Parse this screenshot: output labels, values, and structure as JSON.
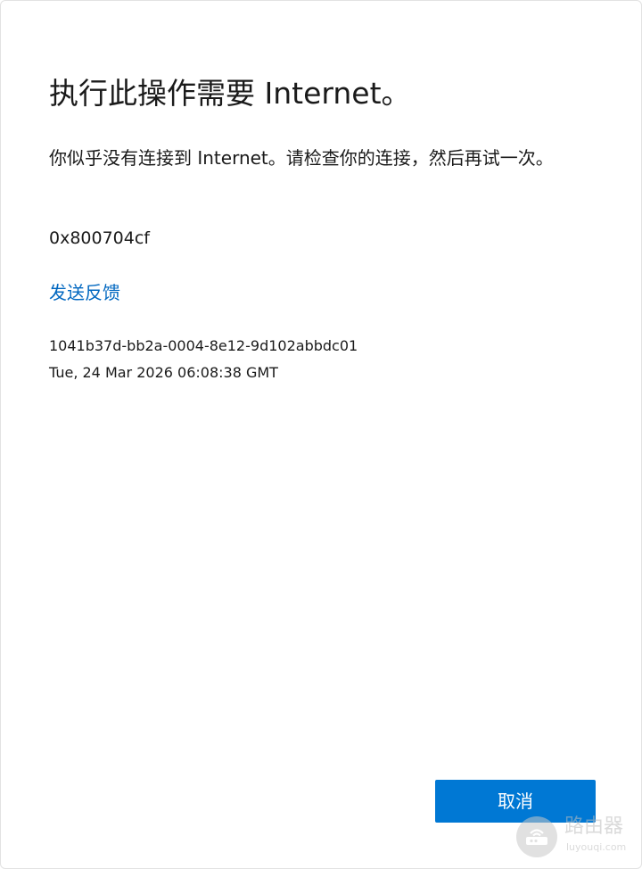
{
  "dialog": {
    "title": "执行此操作需要 Internet。",
    "message": "你似乎没有连接到 Internet。请检查你的连接，然后再试一次。",
    "error_code": "0x800704cf",
    "feedback_link": "发送反馈",
    "correlation_id": "1041b37d-bb2a-0004-8e12-9d102abbdc01",
    "timestamp": "Tue, 24 Mar 2026 06:08:38 GMT",
    "cancel_label": "取消"
  },
  "watermark": {
    "name": "路由器",
    "url": "luyouqi.com",
    "icon": "router-logo-icon"
  },
  "colors": {
    "accent": "#0078d4",
    "link": "#0067c0",
    "text": "#1a1a1a",
    "background": "#ffffff"
  }
}
